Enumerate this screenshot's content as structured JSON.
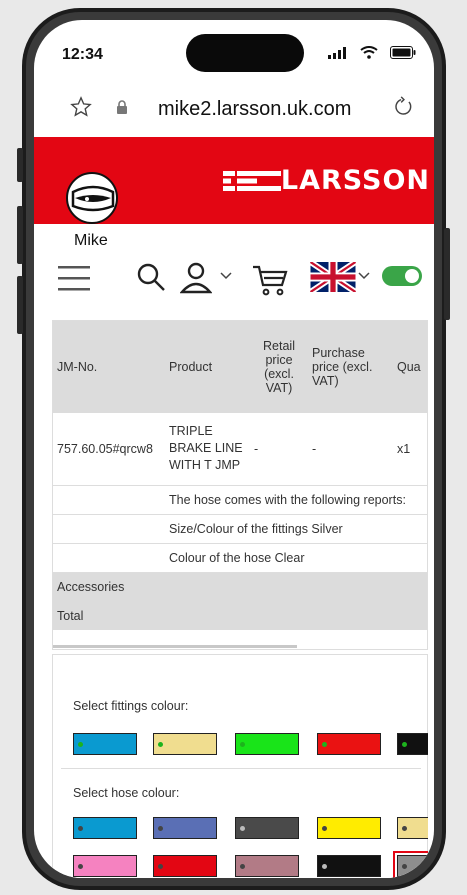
{
  "status": {
    "time": "12:34"
  },
  "browser": {
    "url": "mike2.larsson.uk.com"
  },
  "brand": {
    "logo_text": "LARSSON",
    "color": "#e30613"
  },
  "user": {
    "name": "Mike"
  },
  "table": {
    "headers": [
      "JM-No.",
      "Product",
      "Retail price (excl. VAT)",
      "Purchase price (excl. VAT)",
      "Qua"
    ],
    "row": {
      "jm": "757.60.05#qrcw8",
      "product": "TRIPLE BRAKE LINE WITH T JMP",
      "retail": "-",
      "purchase": "-",
      "qty": "x1"
    },
    "notes": [
      "The hose comes with the following reports:",
      "Size/Colour of the fittings Silver",
      "Colour of the hose Clear"
    ],
    "accessories": "Accessories",
    "total": "Total"
  },
  "fittings": {
    "label": "Select fittings colour:",
    "swatches": [
      {
        "color": "#0a9ad0",
        "dot": "#1db31d"
      },
      {
        "color": "#f0dd8f",
        "dot": "#1db31d"
      },
      {
        "color": "#19e419",
        "dot": "#1db31d"
      },
      {
        "color": "#ea1212",
        "dot": "#1db31d"
      },
      {
        "color": "#111111",
        "dot": "#1db31d"
      }
    ]
  },
  "hose": {
    "label": "Select hose colour:",
    "swatches": [
      {
        "color": "#0a9ad0",
        "dot": "#444"
      },
      {
        "color": "#5a6fb5",
        "dot": "#444"
      },
      {
        "color": "#4a4a4a",
        "dot": "#bbb"
      },
      {
        "color": "#ffec00",
        "dot": "#444"
      },
      {
        "color": "#f0dd8f",
        "dot": "#444"
      },
      {
        "color": "#f582c0",
        "dot": "#444"
      },
      {
        "color": "#e30613",
        "dot": "#444"
      },
      {
        "color": "#b27b86",
        "dot": "#444"
      },
      {
        "color": "#111111",
        "dot": "#bbb"
      },
      {
        "color": "#8e8e8e",
        "dot": "#444"
      }
    ]
  }
}
